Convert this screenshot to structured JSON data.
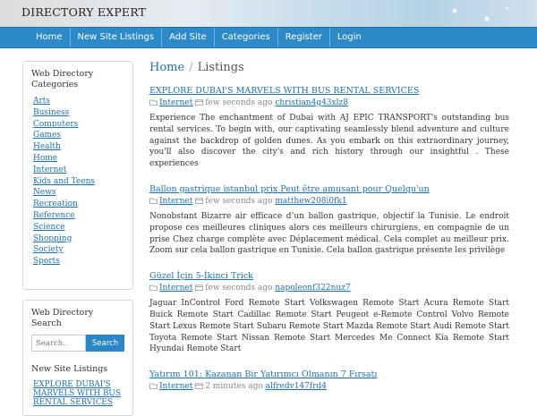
{
  "header": {
    "site_title": "DIRECTORY EXPERT"
  },
  "nav": [
    "Home",
    "New Site Listings",
    "Add Site",
    "Categories",
    "Register",
    "Login"
  ],
  "sidebar": {
    "categories_title": "Web Directory Categories",
    "categories": [
      "Arts",
      "Business",
      "Computers",
      "Games",
      "Health",
      "Home",
      "Internet",
      "Kids and Teens",
      "News",
      "Recreation",
      "Reference",
      "Science",
      "Shopping",
      "Society",
      "Sports"
    ],
    "search_title": "Web Directory Search",
    "search_placeholder": "Search..",
    "search_button": "Search",
    "new_listings_title": "New Site Listings",
    "new_listings": [
      "EXPLORE DUBAI'S MARVELS WITH BUS RENTAL SERVICES"
    ]
  },
  "breadcrumb": {
    "home": "Home",
    "sep": "/",
    "current": "Listings"
  },
  "listings": [
    {
      "title": "EXPLORE DUBAI'S MARVELS WITH BUS RENTAL SERVICES",
      "category": "Internet",
      "time": "few seconds ago",
      "user": "christian4g43xlz8",
      "description": "Experience The enchantment of Dubai with AJ EPIC TRANSPORT's outstanding bus rental services. To begin with, our captivating seamlessly blend adventure and culture against the backdrop of golden dunes. As you embark on this extraordinary journey, you'll also discover the city's and rich history through our insightful . These experiences"
    },
    {
      "title": "Ballon gastrique istanbul prix Peut être amusant pour Quelqu'un",
      "category": "Internet",
      "time": "few seconds ago",
      "user": "matthew208i0fk1",
      "description": "Nonobstant Bizarre air efficace d’un ballon gastrique, objectif la Tunisie. Le endroit propose ces meilleures cliniques alors ces meilleurs chirurgiens, en compagnie de un prise Chez charge complète avec Déplacement médical. Cela complet au meilleur prix. Zoom sur cela ballon gastrique en Tunisie. Cela ballon gastrique présente les privilège"
    },
    {
      "title": "Güzel İçin 5-İkinci Trick",
      "category": "Internet",
      "time": "few seconds ago",
      "user": "napoleonf322nuz7",
      "description": "Jaguar InControl Ford Remote Start Volkswagen Remote Start Acura Remote Start Buick Remote Start Cadillac Remote Start Peugeot e-Remote Control Volvo Remote Start Lexus Remote Start Subaru Remote Start Mazda Remote Start Audi Remote Start Toyota Remote Start Nissan Remote Start Mercedes Me Connect Kia Remote Start Hyundai Remote Start"
    },
    {
      "title": "Yatırım 101: Kazanan Bir Yatırımcı Olmanın 7 Fırsatı",
      "category": "Internet",
      "time": "2 minutes ago",
      "user": "alfredv147frd4",
      "description": ""
    }
  ],
  "colors": {
    "nav_bg": "#2c8ac9",
    "link": "#1d6fb0"
  }
}
